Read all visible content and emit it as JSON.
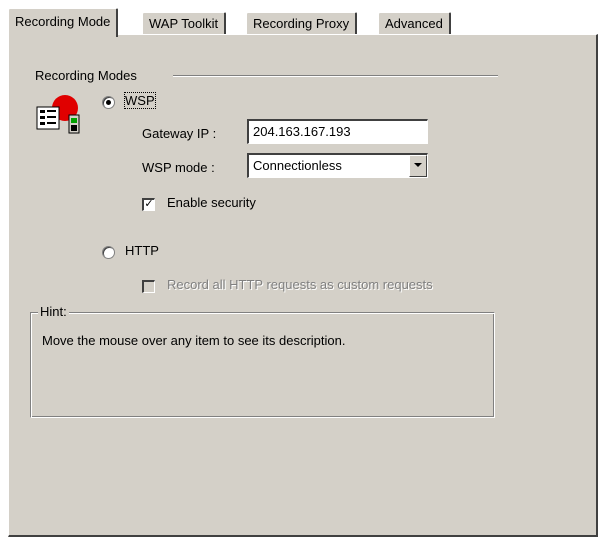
{
  "tabs": [
    {
      "label": "Recording Mode",
      "active": true
    },
    {
      "label": "WAP Toolkit",
      "active": false
    },
    {
      "label": "Recording Proxy",
      "active": false
    },
    {
      "label": "Advanced",
      "active": false
    }
  ],
  "recording_modes": {
    "title": "Recording Modes",
    "wsp": {
      "label": "WSP",
      "selected": true,
      "gateway_ip_label": "Gateway IP :",
      "gateway_ip_value": "204.163.167.193",
      "wsp_mode_label": "WSP mode :",
      "wsp_mode_value": "Connectionless",
      "enable_security_label": "Enable security",
      "enable_security_checked": true
    },
    "http": {
      "label": "HTTP",
      "selected": false,
      "record_all_label": "Record all HTTP requests as custom requests",
      "record_all_checked": false,
      "record_all_disabled": true
    }
  },
  "hint": {
    "title": "Hint:",
    "text": "Move the mouse over any item to see its description."
  },
  "colors": {
    "face": "#d4d0c8",
    "icon_red": "#e00000",
    "disabled_text": "#808080"
  },
  "icons": [
    "recording-app-icon",
    "radio-checked-icon",
    "radio-unchecked-icon",
    "checkbox-checked-icon",
    "dropdown-arrow-icon"
  ]
}
